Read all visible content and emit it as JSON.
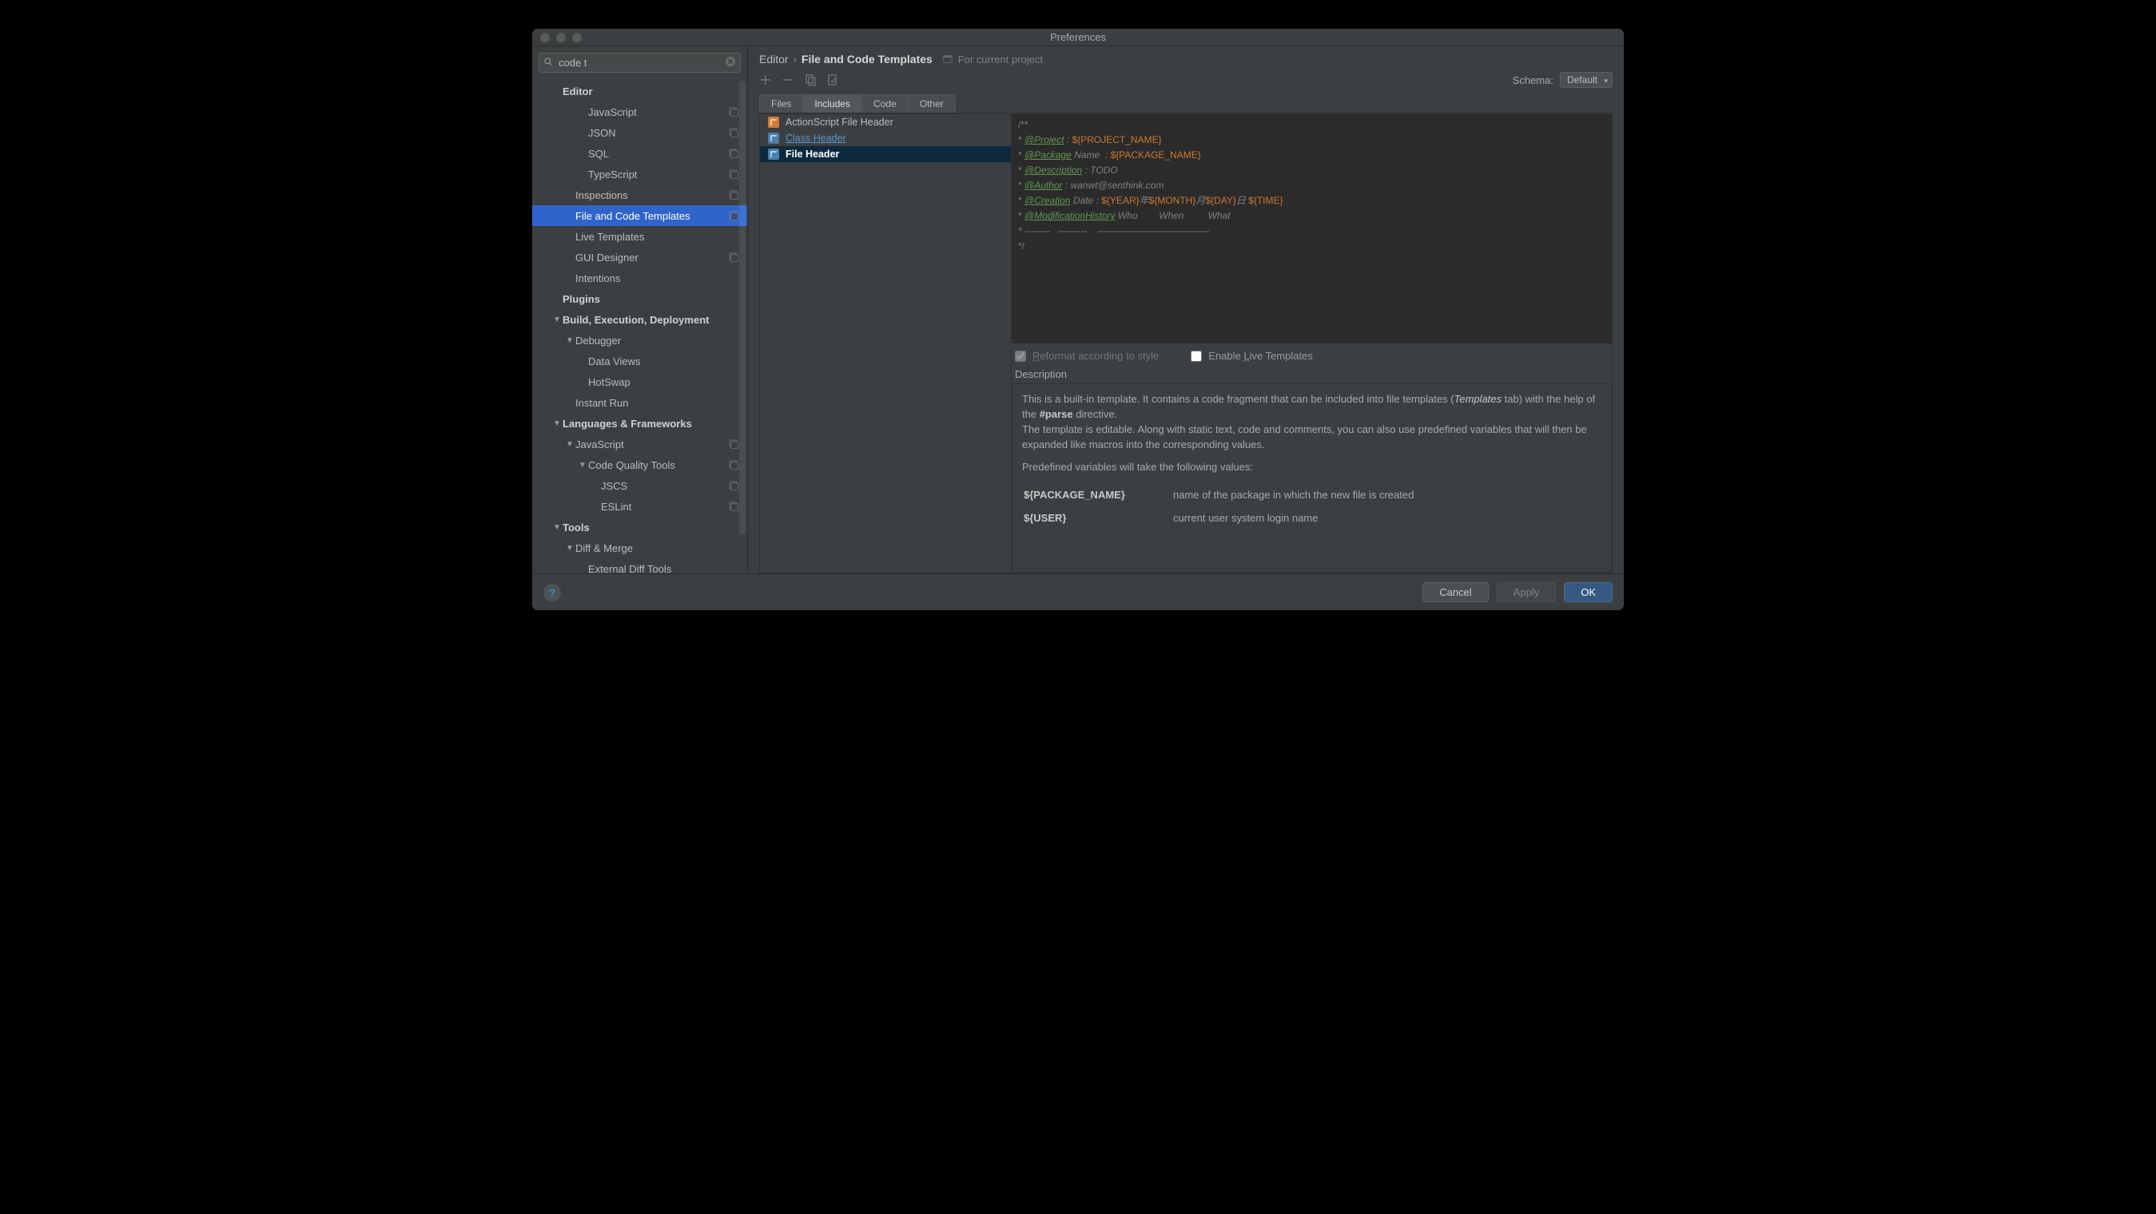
{
  "window": {
    "title": "Preferences"
  },
  "search": {
    "value": "code t"
  },
  "tree": [
    {
      "label": "Editor",
      "depth": 1,
      "bold": true
    },
    {
      "label": "JavaScript",
      "depth": 3,
      "badge": true
    },
    {
      "label": "JSON",
      "depth": 3,
      "badge": true
    },
    {
      "label": "SQL",
      "depth": 3,
      "badge": true
    },
    {
      "label": "TypeScript",
      "depth": 3,
      "badge": true
    },
    {
      "label": "Inspections",
      "depth": 2,
      "badge": true
    },
    {
      "label": "File and Code Templates",
      "depth": 2,
      "badge": true,
      "selected": true
    },
    {
      "label": "Live Templates",
      "depth": 2
    },
    {
      "label": "GUI Designer",
      "depth": 2,
      "badge": true
    },
    {
      "label": "Intentions",
      "depth": 2
    },
    {
      "label": "Plugins",
      "depth": 1,
      "bold": true
    },
    {
      "label": "Build, Execution, Deployment",
      "depth": 1,
      "bold": true,
      "arrow": "▼"
    },
    {
      "label": "Debugger",
      "depth": 2,
      "arrow": "▼"
    },
    {
      "label": "Data Views",
      "depth": 3
    },
    {
      "label": "HotSwap",
      "depth": 3
    },
    {
      "label": "Instant Run",
      "depth": 2
    },
    {
      "label": "Languages & Frameworks",
      "depth": 1,
      "bold": true,
      "arrow": "▼"
    },
    {
      "label": "JavaScript",
      "depth": 2,
      "arrow": "▼",
      "badge": true
    },
    {
      "label": "Code Quality Tools",
      "depth": 3,
      "arrow": "▼",
      "badge": true
    },
    {
      "label": "JSCS",
      "depth": 4,
      "badge": true
    },
    {
      "label": "ESLint",
      "depth": 4,
      "badge": true
    },
    {
      "label": "Tools",
      "depth": 1,
      "bold": true,
      "arrow": "▼"
    },
    {
      "label": "Diff & Merge",
      "depth": 2,
      "arrow": "▼"
    },
    {
      "label": "External Diff Tools",
      "depth": 3
    }
  ],
  "breadcrumb": {
    "parent": "Editor",
    "current": "File and Code Templates",
    "scope": "For current project"
  },
  "schema": {
    "label": "Schema:",
    "value": "Default"
  },
  "tabs": [
    "Files",
    "Includes",
    "Code",
    "Other"
  ],
  "active_tab": "Includes",
  "templates": [
    {
      "label": "ActionScript File Header",
      "icon_color": "#d27b3b"
    },
    {
      "label": "Class Header",
      "icon_color": "#4a7fab",
      "link": true
    },
    {
      "label": "File Header",
      "icon_color": "#4a7fab",
      "selected": true
    }
  ],
  "code_lines": [
    [
      {
        "c": "txt-g",
        "t": "/**"
      }
    ],
    [
      {
        "c": "txt-g",
        "t": "* "
      },
      {
        "c": "kw",
        "t": "@Project"
      },
      {
        "c": "txt-i",
        "t": " : "
      },
      {
        "c": "var",
        "t": "${PROJECT_NAME}"
      }
    ],
    [
      {
        "c": "txt-g",
        "t": "* "
      },
      {
        "c": "kw",
        "t": "@Package"
      },
      {
        "c": "txt-i",
        "t": " Name  : "
      },
      {
        "c": "var",
        "t": "${PACKAGE_NAME}"
      }
    ],
    [
      {
        "c": "txt-g",
        "t": "* "
      },
      {
        "c": "kw",
        "t": "@Description"
      },
      {
        "c": "txt-i",
        "t": " : TODO"
      }
    ],
    [
      {
        "c": "txt-g",
        "t": "* "
      },
      {
        "c": "kw",
        "t": "@Author"
      },
      {
        "c": "txt-i",
        "t": " : wanwt@senthink.com"
      }
    ],
    [
      {
        "c": "txt-g",
        "t": "* "
      },
      {
        "c": "kw",
        "t": "@Creation"
      },
      {
        "c": "txt-i",
        "t": " Date : "
      },
      {
        "c": "var",
        "t": "${YEAR}"
      },
      {
        "c": "txt-i",
        "t": "年"
      },
      {
        "c": "var",
        "t": "${MONTH}"
      },
      {
        "c": "txt-i",
        "t": "月"
      },
      {
        "c": "var",
        "t": "${DAY}"
      },
      {
        "c": "txt-i",
        "t": "日 "
      },
      {
        "c": "var",
        "t": "${TIME}"
      }
    ],
    [
      {
        "c": "txt-g",
        "t": "* "
      },
      {
        "c": "kw",
        "t": "@ModificationHistory"
      },
      {
        "c": "txt-i",
        "t": " Who        When         What"
      }
    ],
    [
      {
        "c": "txt-i",
        "t": "* --------   ---------    -----------------------------------"
      }
    ],
    [
      {
        "c": "txt-g",
        "t": "*/"
      }
    ]
  ],
  "opts": {
    "reformat": "Reformat according to style",
    "enable_live": "Enable Live Templates"
  },
  "desc": {
    "title": "Description",
    "p1a": "This is a built-in template. It contains a code fragment that can be included into file templates (",
    "p1_em": "Templates",
    "p1b": " tab) with the help of the ",
    "p1_b": "#parse",
    "p1c": " directive.",
    "p2": "The template is editable. Along with static text, code and comments, you can also use predefined variables that will then be expanded like macros into the corresponding values.",
    "p3": "Predefined variables will take the following values:",
    "vars": [
      {
        "k": "${PACKAGE_NAME}",
        "v": "name of the package in which the new file is created"
      },
      {
        "k": "${USER}",
        "v": "current user system login name"
      }
    ]
  },
  "buttons": {
    "help": "?",
    "cancel": "Cancel",
    "apply": "Apply",
    "ok": "OK"
  }
}
